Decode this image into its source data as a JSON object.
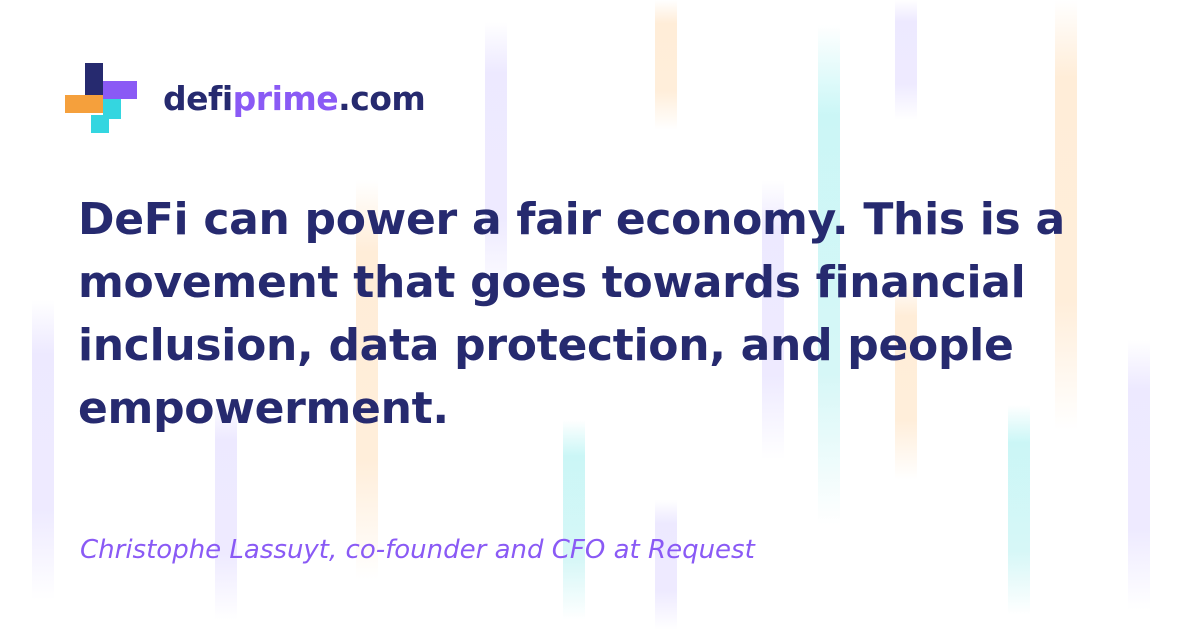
{
  "brand": {
    "name_part1": "defi",
    "name_part2": "prime",
    "name_part3": ".com",
    "colors": {
      "navy": "#262a6f",
      "purple": "#8a5af5",
      "orange": "#f5a03c",
      "cyan": "#34d6e0"
    },
    "logo_icon": "plus-cross-logo-icon"
  },
  "quote": {
    "text": "DeFi can power a fair economy. This is a movement that goes towards financial inclusion, data protection, and people empowerment."
  },
  "attribution": {
    "text": "Christophe Lassuyt, co-founder and CFO at Request"
  }
}
